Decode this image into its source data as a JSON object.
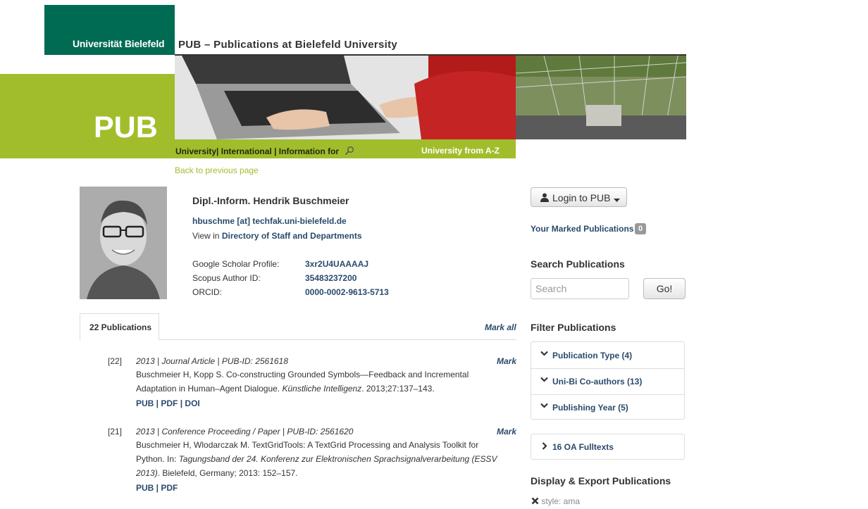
{
  "header": {
    "university_logo": "Universität Bielefeld",
    "site_title": "PUB – Publications at Bielefeld University",
    "pub_logo": "PUB",
    "nav_university": "University",
    "nav_international": "International",
    "nav_information_for": "Information for",
    "nav_a_z": "University from A-Z"
  },
  "back_link": "Back to previous page",
  "profile": {
    "name": "Dipl.-Inform. Hendrik Buschmeier",
    "email": "hbuschme [at] techfak.uni-bielefeld.de",
    "view_in_prefix": "View in ",
    "view_in_link": "Directory of Staff and Departments",
    "fields": [
      {
        "label": "Google Scholar Profile:",
        "value": "3xr2U4UAAAAJ"
      },
      {
        "label": "Scopus Author ID:",
        "value": "35483237200"
      },
      {
        "label": "ORCID:",
        "value": "0000-0002-9613-5713"
      }
    ]
  },
  "tabs": {
    "active": "22 Publications",
    "mark_all": "Mark all"
  },
  "publications": [
    {
      "num": "[22]",
      "meta": "2013 | Journal Article | PUB-ID: 2561618",
      "mark": "Mark",
      "text_plain": "Buschmeier H, Kopp S. Co-constructing Grounded Symbols—Feedback and Incremental Adaptation in Human–Agent Dialogue. ",
      "text_italic": "Künstliche Intelligenz",
      "text_end": ". 2013;27:137–143.",
      "links": [
        "PUB",
        "PDF",
        "DOI"
      ]
    },
    {
      "num": "[21]",
      "meta": "2013 | Conference Proceeding / Paper | PUB-ID: 2561620",
      "mark": "Mark",
      "text_plain": "Buschmeier H, Wlodarczak M. TextGridTools: A TextGrid Processing and Analysis Toolkit for Python. In: ",
      "text_italic": "Tagungsband der 24. Konferenz zur Elektronischen Sprachsignalverarbeitung (ESSV 2013)",
      "text_end": ". Bielefeld, Germany; 2013: 152–157.",
      "links": [
        "PUB",
        "PDF"
      ]
    }
  ],
  "sidebar": {
    "login": "Login to PUB",
    "marked_label": "Your Marked Publications",
    "marked_count": "0",
    "search_heading": "Search Publications",
    "search_placeholder": "Search",
    "go": "Go!",
    "filter_heading": "Filter Publications",
    "filters": [
      "Publication Type (4)",
      "Uni-Bi Co-authors (13)",
      "Publishing Year (5)"
    ],
    "oa": "16 OA Fulltexts",
    "display_heading": "Display & Export Publications",
    "style": "style: ama"
  }
}
